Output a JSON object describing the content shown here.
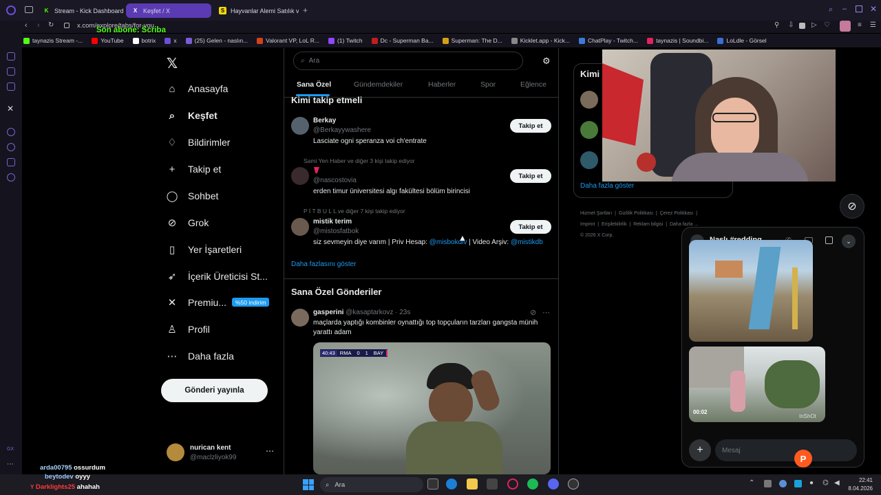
{
  "browser": {
    "tabs": [
      {
        "label": "Stream - Kick Dashboard",
        "fav": "K",
        "color": "#53fc18"
      },
      {
        "label": "Keşfet / X",
        "fav": "X",
        "color": "#ffffff"
      },
      {
        "label": "Hayvanlar Alemi Satılık ve",
        "fav": "S",
        "color": "#f5d90a"
      }
    ],
    "url": "x.com/explore/tabs/for-you",
    "overlay_sub": "Son abone: Scriba",
    "bookmarks": [
      {
        "label": "taynazis Stream -...",
        "color": "#53fc18"
      },
      {
        "label": "YouTube",
        "color": "#ff0000"
      },
      {
        "label": "botrix",
        "color": "#ffffff"
      },
      {
        "label": "x",
        "color": "#6b4fd8"
      },
      {
        "label": "(25) Gelen - naslın...",
        "color": "#7b5cd6"
      },
      {
        "label": "Valorant VP, LoL R...",
        "color": "#d1431b"
      },
      {
        "label": "(1) Twitch",
        "color": "#9146ff"
      },
      {
        "label": "Dc - Superman Ba...",
        "color": "#c41d1d"
      },
      {
        "label": "Superman: The D...",
        "color": "#d4a017"
      },
      {
        "label": "Kicklet.app - Kick...",
        "color": "#888888"
      },
      {
        "label": "ChatPlay - Twitch...",
        "color": "#3d7bd9"
      },
      {
        "label": "taynazis | Soundbi...",
        "color": "#e0245e"
      },
      {
        "label": "LoLdle - Görsel",
        "color": "#3b6fd1"
      }
    ]
  },
  "nav": {
    "items": [
      {
        "label": "Anasayfa",
        "icon": "home-icon",
        "glyph": "⌂"
      },
      {
        "label": "Keşfet",
        "icon": "search-icon",
        "glyph": "⌕"
      },
      {
        "label": "Bildirimler",
        "icon": "bell-icon",
        "glyph": "♢"
      },
      {
        "label": "Takip et",
        "icon": "add-person-icon",
        "glyph": "+"
      },
      {
        "label": "Sohbet",
        "icon": "chat-icon",
        "glyph": "◯"
      },
      {
        "label": "Grok",
        "icon": "grok-icon",
        "glyph": "⊘"
      },
      {
        "label": "Yer İşaretleri",
        "icon": "bookmark-icon",
        "glyph": "▯"
      },
      {
        "label": "İçerik Üreticisi St...",
        "icon": "rocket-icon",
        "glyph": "➶"
      },
      {
        "label": "Premiu...",
        "icon": "x-premium-icon",
        "glyph": "✕"
      },
      {
        "label": "Profil",
        "icon": "profile-icon",
        "glyph": "♙"
      },
      {
        "label": "Daha fazla",
        "icon": "more-circle-icon",
        "glyph": "⋯"
      }
    ],
    "premium_badge": "%50 indirim",
    "post_button": "Gönderi yayınla",
    "account_name": "nurican kent",
    "account_handle": "@maclzliyok99"
  },
  "search": {
    "placeholder": "Ara"
  },
  "explore_tabs": [
    "Sana Özel",
    "Gündemdekiler",
    "Haberler",
    "Spor",
    "Eğlence"
  ],
  "who_to_follow": {
    "title": "Kimi takip etmeli",
    "follow_label": "Takip et",
    "show_more": "Daha fazlasını göster",
    "users": [
      {
        "social": "",
        "name": "Berkay",
        "handle": "@Berkayywashere",
        "bio": "Lasciate ogni speranza voi ch'entrate"
      },
      {
        "social": "Sami Yen Haber ve diğer 3 kişi takip ediyor",
        "name": "",
        "handle": "@nascostovia",
        "bio": "erden timur üniversitesi algı fakültesi bölüm birincisi"
      },
      {
        "social": "P İ T B U L L ve diğer 7 kişi takip ediyor",
        "name": "mistik terim",
        "handle": "@mistosfatbok",
        "bio_pre": "siz sevmeyin diye varım | Priv Hesap: ",
        "bio_link1": "@misbokdiv",
        "bio_mid": " | Video Arşiv: ",
        "bio_link2": "@mistikdb"
      }
    ]
  },
  "posts": {
    "title": "Sana Özel Gönderiler",
    "author": "gasperini",
    "handle": "@kasaptarkovz",
    "time": "· 23s",
    "text": "maçlarda yaptığı kombinler oynattığı top topçuların tarzları gangsta münih yarattı adam",
    "scoreboard": {
      "clock": "40:43",
      "home": "RMA",
      "home_score": "0",
      "away_score": "1",
      "away": "BAY"
    }
  },
  "right": {
    "kimi": "Kimi",
    "show_more": "Daha fazla göster",
    "footer": [
      "Hizmet Şartları",
      "Gizlilik Politikası",
      "Çerez Politikası",
      "Imprint",
      "Erişilebilirlik",
      "Reklam bilgisi",
      "Daha fazla ...",
      "© 2026 X Corp."
    ]
  },
  "dm": {
    "title": "Naslı #redding...",
    "video_time": "00:02",
    "watermark": "InShOt",
    "placeholder": "Mesaj"
  },
  "chat": [
    {
      "user": "arda00795",
      "msg": "ossurdum",
      "color": "#a9d5ff"
    },
    {
      "user": "beytodev",
      "msg": "oyyy",
      "color": "#9fc6ff"
    },
    {
      "user": "Darklights25",
      "msg": "ahahah",
      "color": "#ff3b3b"
    }
  ],
  "taskbar": {
    "search": "Ara",
    "time": "22:41",
    "date": "8.04.2026"
  }
}
